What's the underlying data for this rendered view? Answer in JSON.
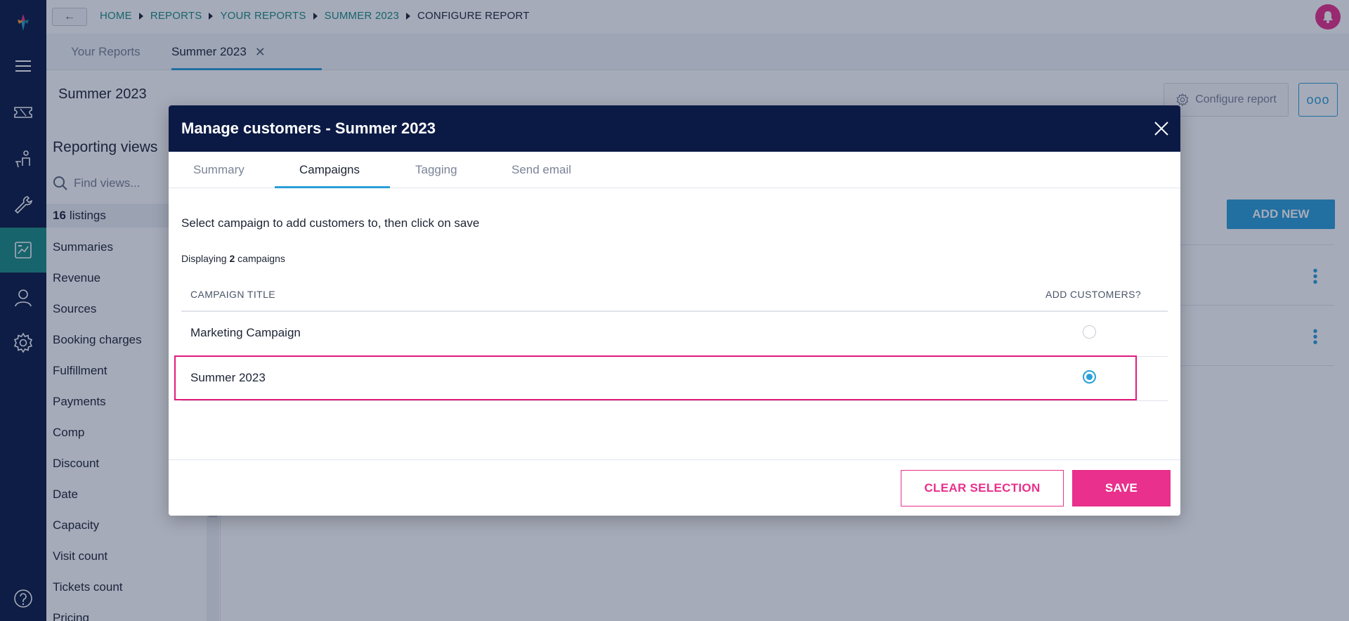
{
  "breadcrumb": [
    "HOME",
    "REPORTS",
    "YOUR REPORTS",
    "SUMMER 2023",
    "CONFIGURE REPORT"
  ],
  "tabs": {
    "your_reports": "Your Reports",
    "summer": "Summer 2023"
  },
  "page": {
    "title": "Summer 2023",
    "configure_label": "Configure report",
    "more_label": "ooo"
  },
  "views": {
    "title": "Reporting views",
    "search_placeholder": "Find views...",
    "count": "16",
    "count_suffix": "listings",
    "items": [
      "Summaries",
      "Revenue",
      "Sources",
      "Booking charges",
      "Fulfillment",
      "Payments",
      "Comp",
      "Discount",
      "Date",
      "Capacity",
      "Visit count",
      "Tickets count",
      "Pricing"
    ]
  },
  "main": {
    "add_new": "ADD NEW"
  },
  "modal": {
    "title": "Manage customers - Summer 2023",
    "tabs": [
      "Summary",
      "Campaigns",
      "Tagging",
      "Send email"
    ],
    "active_tab": "Campaigns",
    "instruction": "Select campaign to add customers to, then click on save",
    "displaying_prefix": "Displaying",
    "displaying_count": "2",
    "displaying_suffix": "campaigns",
    "col_title": "CAMPAIGN TITLE",
    "col_add": "ADD CUSTOMERS?",
    "rows": [
      {
        "name": "Marketing Campaign",
        "selected": false
      },
      {
        "name": "Summer 2023",
        "selected": true
      }
    ],
    "clear_label": "CLEAR SELECTION",
    "save_label": "SAVE"
  },
  "colors": {
    "nav": "#0b1a45",
    "accent_teal": "#1a8d84",
    "accent_blue": "#2a9fd8",
    "accent_pink": "#e8308c"
  }
}
